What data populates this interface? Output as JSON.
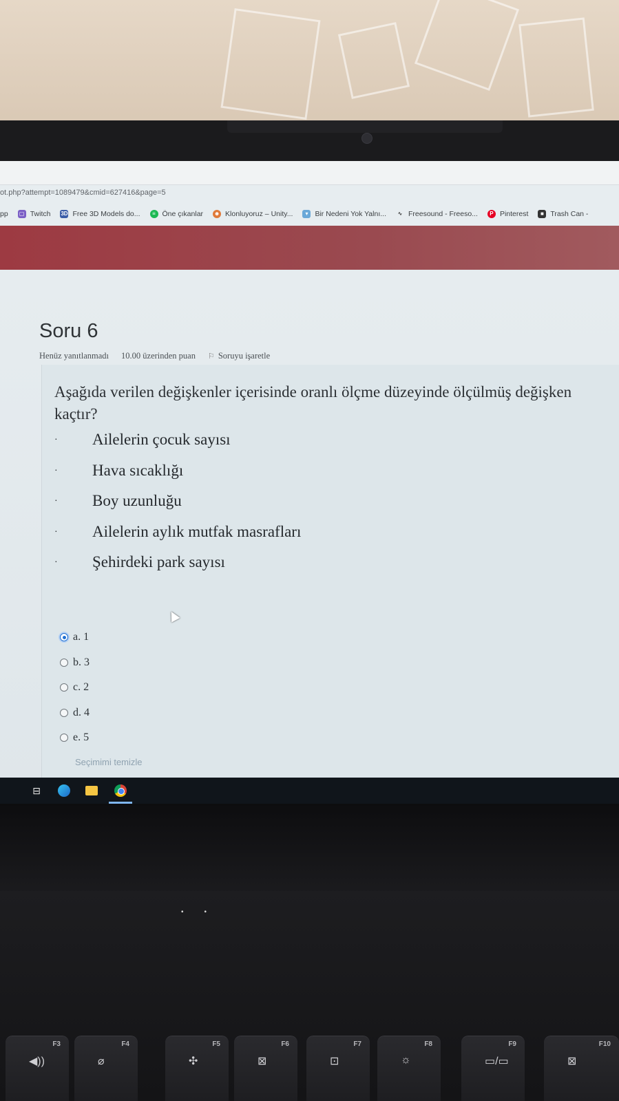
{
  "browser": {
    "url": "ot.php?attempt=1089479&cmid=627416&page=5",
    "bookmarks": [
      {
        "label": "pp",
        "icon": "none"
      },
      {
        "label": "Twitch",
        "icon": "twitch-icon"
      },
      {
        "label": "Free 3D Models do...",
        "icon": "3d-icon"
      },
      {
        "label": "Öne çıkanlar",
        "icon": "spotify-icon"
      },
      {
        "label": "Klonluyoruz – Unity...",
        "icon": "character-icon"
      },
      {
        "label": "Bir Nedeni Yok Yalnı...",
        "icon": "cup-icon"
      },
      {
        "label": "Freesound - Freeso...",
        "icon": "waveform-icon"
      },
      {
        "label": "Pinterest",
        "icon": "pinterest-icon"
      },
      {
        "label": "Trash Can -",
        "icon": "trash-site-icon"
      }
    ]
  },
  "question": {
    "title": "Soru 6",
    "status": "Henüz yanıtlanmadı",
    "points": "10.00 üzerinden puan",
    "flag_label": "Soruyu işaretle",
    "text_line1": "Aşağıda verilen değişkenler içerisinde oranlı ölçme düzeyinde ölçülmüş değişken",
    "text_line2": "kaçtır?",
    "items": [
      "Ailelerin çocuk sayısı",
      "Hava sıcaklığı",
      "Boy uzunluğu",
      "Ailelerin aylık mutfak masrafları",
      "Şehirdeki park sayısı"
    ],
    "bullet": "·",
    "answers": [
      {
        "label": "a. 1",
        "selected": true
      },
      {
        "label": "b. 3",
        "selected": false
      },
      {
        "label": "c. 2",
        "selected": false
      },
      {
        "label": "d. 4",
        "selected": false
      },
      {
        "label": "e. 5",
        "selected": false
      }
    ],
    "clear_label": "Seçimimi temizle"
  },
  "keyboard": {
    "keys": [
      "F3",
      "F4",
      "F5",
      "F6",
      "F7",
      "F8",
      "F9",
      "F10"
    ]
  },
  "colors": {
    "banner": "#9d3a42",
    "radio_selected": "#1f6fd1"
  }
}
